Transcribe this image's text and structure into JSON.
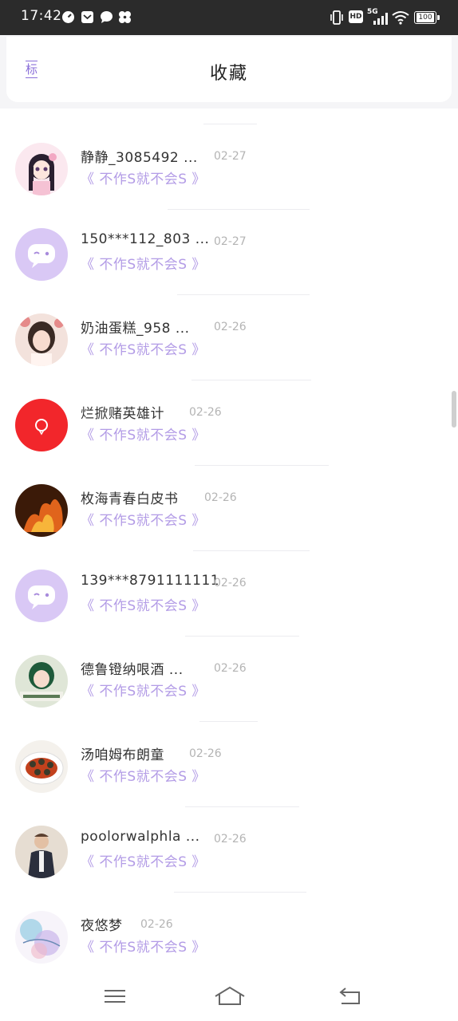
{
  "status_bar": {
    "time": "17:42",
    "icons_left": [
      "clock-icon",
      "mail-icon",
      "chat-bubble-icon",
      "pinwheel-icon"
    ],
    "icons_right": [
      "vibrate-icon",
      "hd-icon",
      "signal-5g-icon",
      "wifi-icon",
      "battery-icon"
    ],
    "signal_label": "5G",
    "hd_label": "HD",
    "battery": "100"
  },
  "header": {
    "tab_mark": "标",
    "title": "收藏"
  },
  "items": [
    {
      "name": "静静_3085492 ...",
      "date": "02-27",
      "subtitle": "《 不作S就不会S 》",
      "avatar": "anime-girl"
    },
    {
      "name": "150***112_803 ...",
      "date": "02-27",
      "subtitle": "《 不作S就不会S 》",
      "avatar": "default-purple"
    },
    {
      "name": "奶油蛋糕_958 ...",
      "date": "02-26",
      "subtitle": "《 不作S就不会S 》",
      "avatar": "photo-girl"
    },
    {
      "name": "烂掀赌英雄计",
      "date": "02-26",
      "subtitle": "《 不作S就不会S 》",
      "avatar": "red-logo"
    },
    {
      "name": "枚海青春白皮书",
      "date": "02-26",
      "subtitle": "《 不作S就不会S 》",
      "avatar": "fire"
    },
    {
      "name": "139***8791111111",
      "date": "02-26",
      "subtitle": "《 不作S就不会S 》",
      "avatar": "default-purple"
    },
    {
      "name": "德鲁镫纳哏酒 ...",
      "date": "02-26",
      "subtitle": "《 不作S就不会S 》",
      "avatar": "photo-child"
    },
    {
      "name": "汤咱姆布朗童",
      "date": "02-26",
      "subtitle": "《 不作S就不会S 》",
      "avatar": "food-plate"
    },
    {
      "name": "poolorwalphla ...",
      "date": "02-26",
      "subtitle": "《 不作S就不会S 》",
      "avatar": "photo-man"
    },
    {
      "name": "夜悠梦",
      "date": "02-26",
      "subtitle": "《 不作S就不会S 》",
      "avatar": "watercolor"
    }
  ],
  "nav": {
    "buttons": [
      "menu-icon",
      "home-icon",
      "back-icon"
    ]
  },
  "colors": {
    "accent": "#b39ce6",
    "status_bar": "#2b2b2b",
    "default_avatar": "#d9c8f5"
  }
}
